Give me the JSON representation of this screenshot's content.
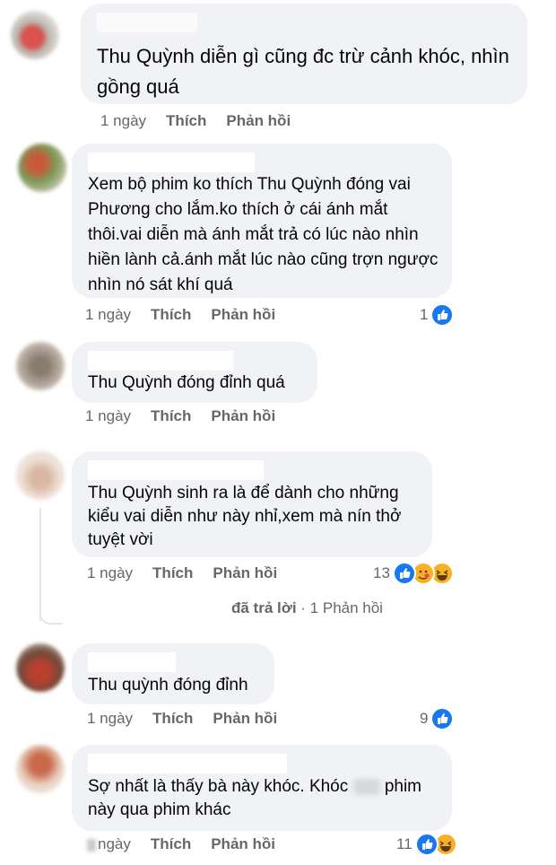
{
  "comments": [
    {
      "text": "Thu Quỳnh diễn gì cũng đc trừ cảnh khóc, nhìn gồng quá",
      "age": "1 ngày",
      "like": "Thích",
      "reply": "Phản hồi",
      "reaction_count": ""
    },
    {
      "text": "Xem bộ phim ko thích Thu Quỳnh đóng  vai Phương cho lắm.ko thích ở cái ánh mắt thôi.vai diễn mà ánh mắt trả có lúc nào nhìn hiền lành cả.ánh mắt lúc nào cũng trợn ngược nhìn nó sát khí quá",
      "age": "1 ngày",
      "like": "Thích",
      "reply": "Phản hồi",
      "reaction_count": "1"
    },
    {
      "text": "Thu  Quỳnh đóng đỉnh quá",
      "age": "1 ngày",
      "like": "Thích",
      "reply": "Phản hồi",
      "reaction_count": ""
    },
    {
      "text": "Thu Quỳnh sinh ra là để dành cho những kiểu vai diễn như này nhỉ,xem mà nín thở tuyệt vời",
      "age": "1 ngày",
      "like": "Thích",
      "reply": "Phản hồi",
      "reaction_count": "13"
    },
    {
      "text": "Thu quỳnh đóng đỉnh",
      "age": "1 ngày",
      "like": "Thích",
      "reply": "Phản hồi",
      "reaction_count": "9"
    },
    {
      "text_before": "Sợ nhất là thấy bà này khóc. Khóc",
      "text_after": "phim này qua phim khác",
      "age": "ngày",
      "like": "Thích",
      "reply": "Phản hồi",
      "reaction_count": "11"
    }
  ],
  "replies_summary": {
    "replied": "đã trả lời",
    "separator": " · ",
    "count": "1 Phản hồi"
  },
  "colors": {
    "bubble": "#f0f2f5",
    "meta": "#65676b",
    "like_blue": "#1877f2",
    "emoji_yellow": "#f7b125"
  }
}
